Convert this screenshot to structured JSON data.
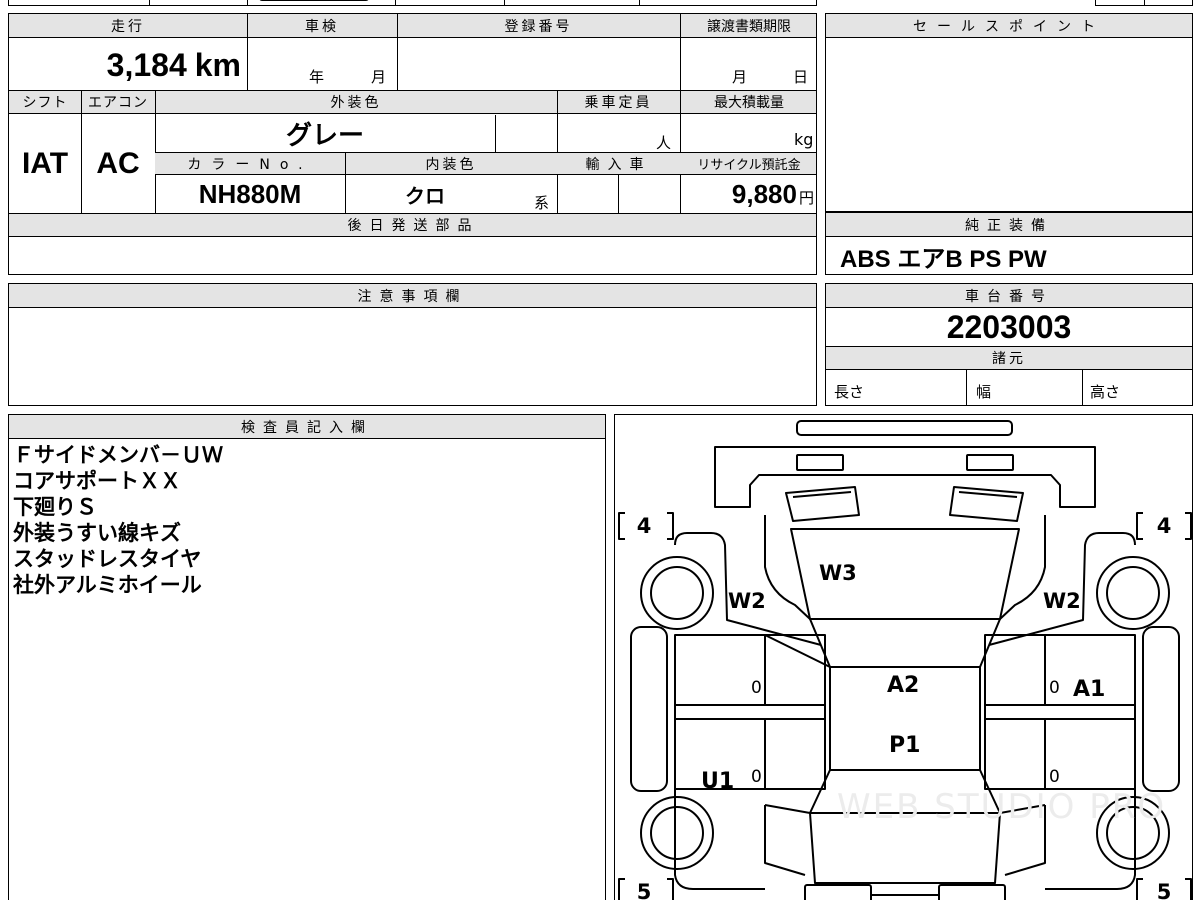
{
  "sheet": {
    "mileage": {
      "label": "走行",
      "value": "3,184",
      "unit": "km"
    },
    "shaken": {
      "label": "車検",
      "year_unit": "年",
      "month_unit": "月",
      "value": ""
    },
    "registration_number": {
      "label": "登録番号",
      "value": ""
    },
    "transfer_deadline": {
      "label": "譲渡書類期限",
      "month_unit": "月",
      "day_unit": "日"
    },
    "shift": {
      "label": "シフト",
      "value": "IAT"
    },
    "aircon": {
      "label": "エアコン",
      "value": "AC"
    },
    "exterior_color": {
      "label": "外装色",
      "value": "グレー"
    },
    "capacity": {
      "label": "乗車定員",
      "unit": "人",
      "value": ""
    },
    "max_load": {
      "label": "最大積載量",
      "unit": "kg",
      "value": ""
    },
    "color_no": {
      "label": "カラーNo.",
      "value": "NH880M"
    },
    "interior_color": {
      "label": "内装色",
      "value": "クロ",
      "suffix": "系"
    },
    "import": {
      "label": "輸入車",
      "value": ""
    },
    "recycle_fee": {
      "label": "リサイクル預託金",
      "value": "9,880",
      "unit": "円"
    },
    "later_parts": {
      "label": "後日発送部品",
      "value": ""
    },
    "sales_point": {
      "label": "セールスポイント",
      "value": ""
    },
    "genuine_equipment": {
      "label": "純正装備",
      "value": "ABS エアB PS PW"
    },
    "notes": {
      "label": "注意事項欄",
      "value": ""
    },
    "chassis_number": {
      "label": "車台番号",
      "value": "2203003"
    },
    "specs": {
      "label": "諸元",
      "length": "長さ",
      "width": "幅",
      "height": "高さ"
    },
    "inspector": {
      "label": "検査員記入欄",
      "lines": [
        "Ｆサイドメンバ－ＵＷ",
        "コアサポートＸＸ",
        "下廻りＳ",
        "外装うすい線キズ",
        "スタッドレスタイヤ",
        "社外アルミホイール"
      ]
    }
  },
  "diagram": {
    "marks": {
      "w3": "W3",
      "w2_left": "W2",
      "w2_right": "W2",
      "a2": "A2",
      "p1": "P1",
      "a1": "A1",
      "u1": "U1",
      "zero_1": "0",
      "zero_2": "0",
      "zero_3": "0",
      "zero_4": "0"
    },
    "tires": {
      "front_left": "4",
      "front_right": "4",
      "rear_left": "5",
      "rear_right": "5"
    }
  },
  "watermark": "WEB STUDIO PRO"
}
